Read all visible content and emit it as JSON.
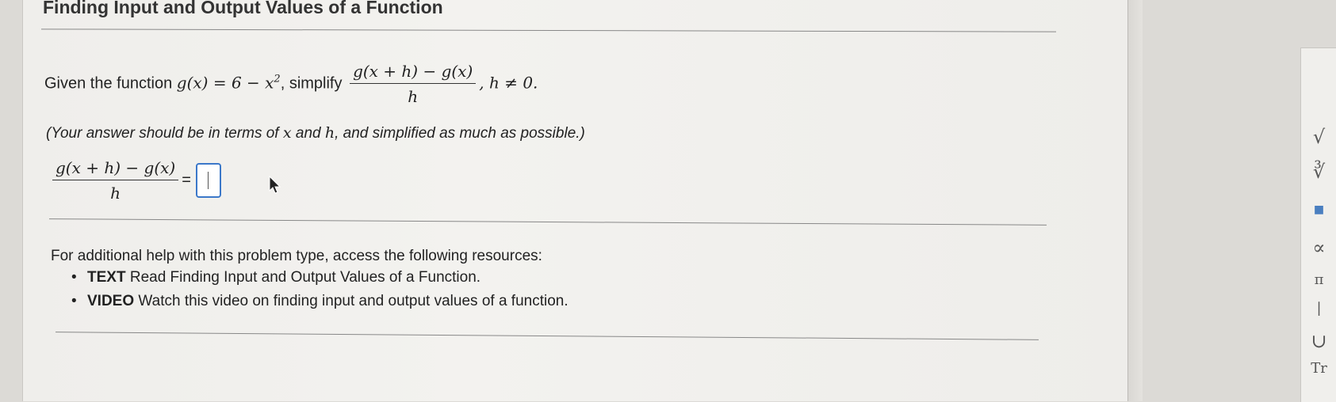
{
  "header": {
    "title": "Finding Input and Output Values of a Function"
  },
  "question": {
    "intro": "Given the function",
    "function_def": "g(x) = 6 − x",
    "exponent": "2",
    "simplify_text": ", simplify",
    "numerator": "g(x + h) − g(x)",
    "denominator": "h",
    "condition": ", h ≠ 0."
  },
  "instruction": {
    "part1": "(Your answer should be in terms of ",
    "var_x": "x",
    "part2": " and ",
    "var_h": "h",
    "part3": ", and simplified as much as possible.)"
  },
  "answer": {
    "numerator": "g(x + h) − g(x)",
    "denominator": "h",
    "equals": "=",
    "value": ""
  },
  "help": {
    "heading": "For additional help with this problem type, access the following resources:",
    "resources": [
      {
        "type": "TEXT",
        "text": " Read Finding Input and Output Values of a Function."
      },
      {
        "type": "VIDEO",
        "text": " Watch this video on finding input and output values of a function."
      }
    ]
  },
  "toolbar": {
    "items": [
      "√",
      "∛",
      "■",
      "∝",
      "π",
      "|",
      "∪",
      "Tr"
    ]
  },
  "colors": {
    "accent": "#3b78c9",
    "page_bg": "#f1f0ed",
    "rule": "#888888"
  }
}
